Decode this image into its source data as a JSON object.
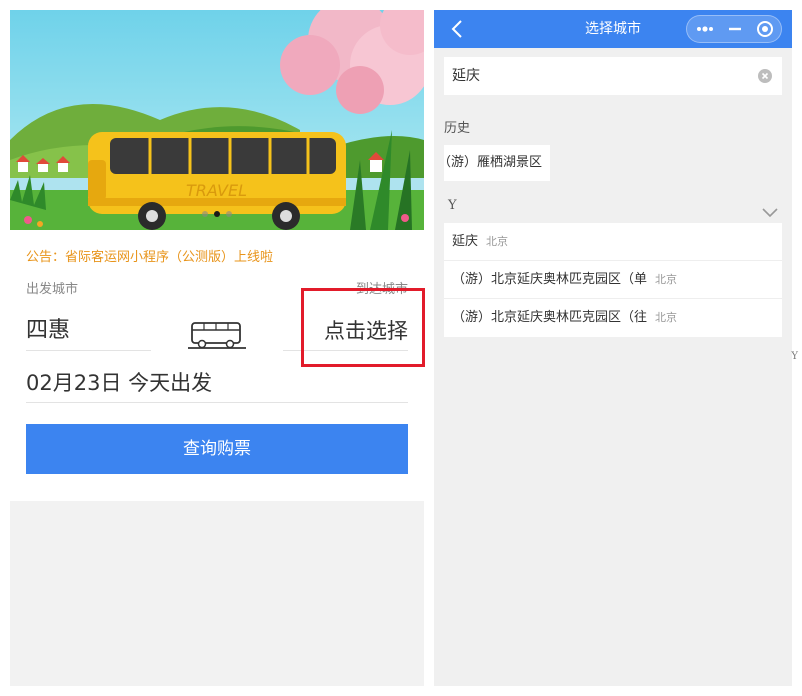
{
  "left": {
    "banner": {
      "text": "TRAVEL",
      "active_dot": 1,
      "dot_count": 3
    },
    "notice": "公告：省际客运网小程序（公测版）上线啦",
    "from_label": "出发城市",
    "to_label": "到达城市",
    "from_city": "四惠",
    "to_city_placeholder": "点击选择",
    "date_text": "02月23日 今天出发",
    "search_button": "查询购票",
    "colors": {
      "accent": "#3c84f0",
      "notice": "#e8941a",
      "highlight": "#e21b2a"
    }
  },
  "right": {
    "nav": {
      "title": "选择城市",
      "back_icon": "chevron-left-icon",
      "more_icon": "more-dots-icon",
      "minimize_icon": "minus-icon",
      "close_icon": "target-close-icon"
    },
    "search": {
      "value": "延庆",
      "clear_icon": "clear-circle-icon"
    },
    "history_label": "历史",
    "history_items": [
      "（游）雁栖湖景区（往"
    ],
    "group_letter": "Y",
    "results": [
      {
        "name": "延庆",
        "city": "北京"
      },
      {
        "name": "（游）北京延庆奥林匹克园区（单",
        "city": "北京"
      },
      {
        "name": "（游）北京延庆奥林匹克园区（往",
        "city": "北京"
      }
    ],
    "index_letters": [
      "Y"
    ]
  }
}
